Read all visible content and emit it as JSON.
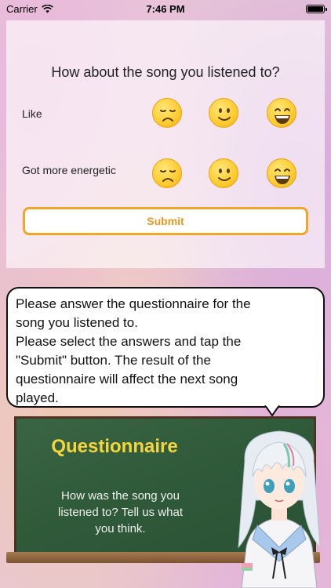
{
  "status_bar": {
    "carrier": "Carrier",
    "time": "7:46 PM"
  },
  "questionnaire": {
    "title": "How about the song you listened to?",
    "questions": [
      {
        "label": "Like",
        "options": [
          "sad-face-icon",
          "smile-face-icon",
          "grin-face-icon"
        ]
      },
      {
        "label": "Got more energetic",
        "options": [
          "sad-face-icon",
          "smile-face-icon",
          "grin-face-icon"
        ]
      }
    ],
    "submit_label": "Submit"
  },
  "bubble": {
    "lines": [
      "Please answer the questionnaire for the",
      "song you listened to.",
      "Please select the answers and tap the",
      "\"Submit\" button. The result of the",
      "questionnaire will affect the next song",
      "played."
    ]
  },
  "board": {
    "title": "Questionnaire",
    "text_lines": [
      "How was the song you",
      "listened to? Tell us what",
      "you think."
    ]
  },
  "colors": {
    "accent_orange": "#f2a629",
    "board_green": "#2f5a3a",
    "board_title_yellow": "#f6d53a"
  }
}
